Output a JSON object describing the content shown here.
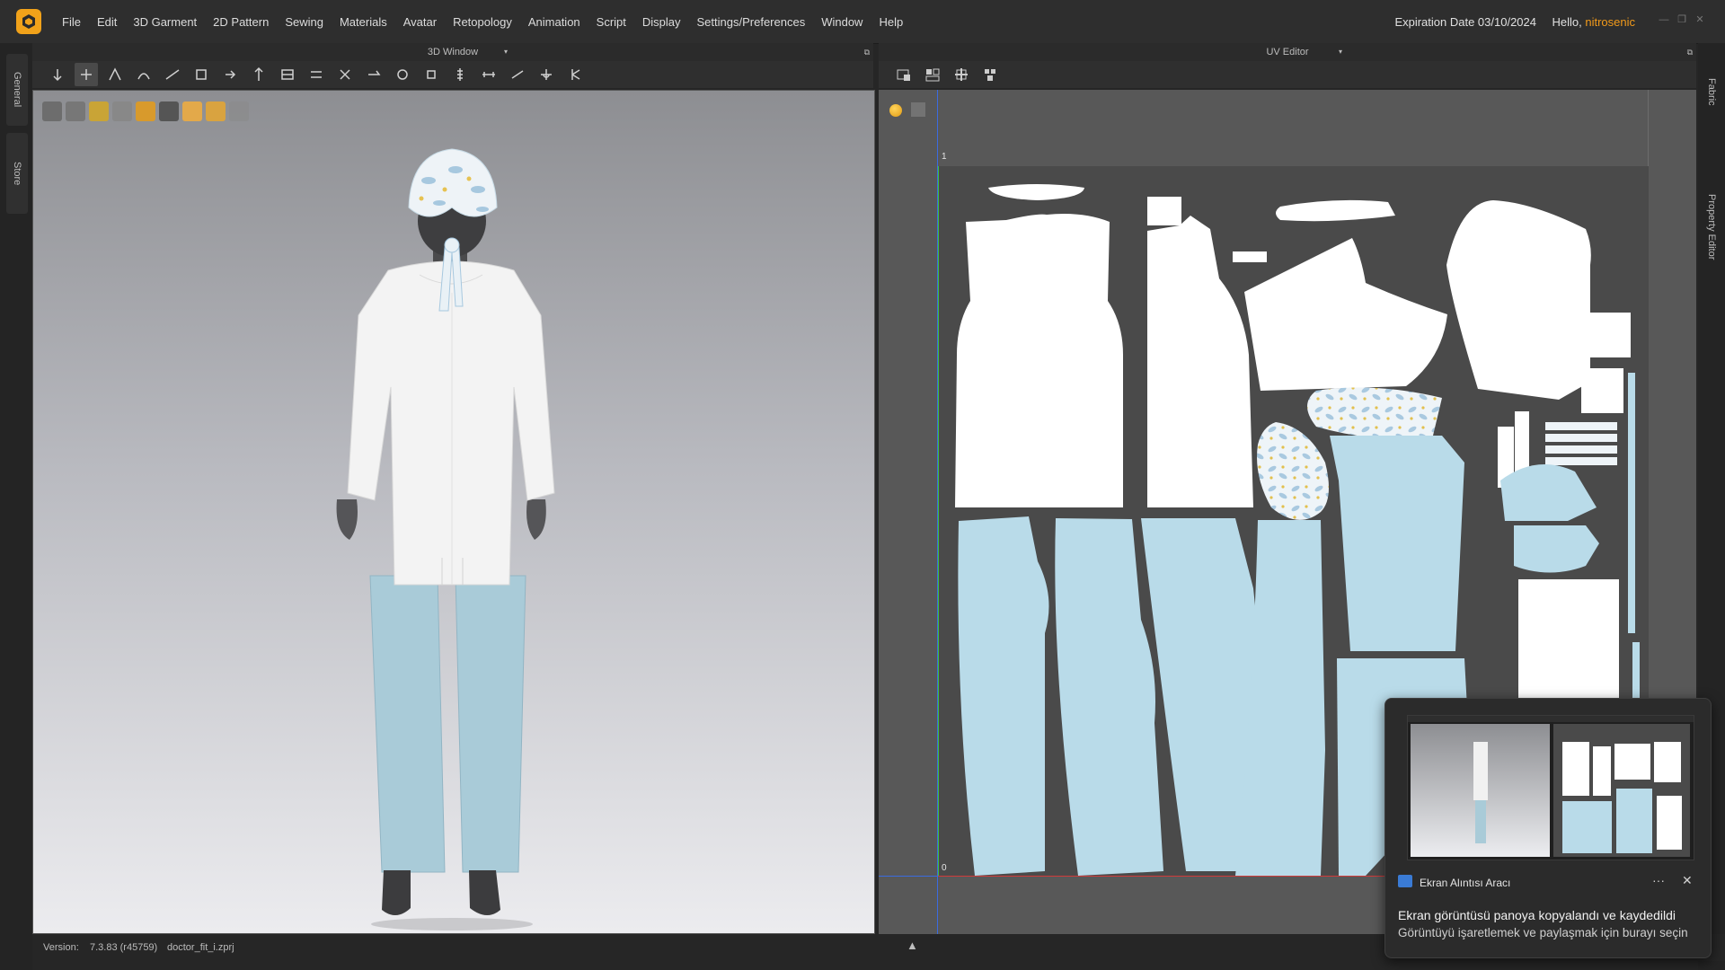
{
  "app": {
    "menu": [
      "File",
      "Edit",
      "3D Garment",
      "2D Pattern",
      "Sewing",
      "Materials",
      "Avatar",
      "Retopology",
      "Animation",
      "Script",
      "Display",
      "Settings/Preferences",
      "Window",
      "Help"
    ],
    "expiration": "Expiration Date 03/10/2024",
    "hello_prefix": "Hello,",
    "username": "nitrosenic",
    "accent_color": "#f29a1a"
  },
  "left_dock": {
    "tabs": [
      "General",
      "Store"
    ]
  },
  "right_dock": {
    "tabs": [
      "Fabric",
      "Property Editor"
    ]
  },
  "view3d": {
    "title": "3D Window",
    "toolbar_icons": [
      "select-move-icon",
      "transform-icon",
      "edit-point-icon",
      "edit-curvature-icon",
      "ruler-icon",
      "steam-icon",
      "fold-icon",
      "pin-icon",
      "strengthen-icon",
      "tuck-icon",
      "shrinkage-icon",
      "fitting-icon",
      "button-icon",
      "buttonhole-icon",
      "zipper-icon",
      "measure-icon",
      "tape-icon",
      "avatar-measure-icon",
      "simulate-icon"
    ]
  },
  "uv_editor": {
    "title": "UV Editor",
    "axis_label_top": "1",
    "axis_label_bottom": "0"
  },
  "statusbar": {
    "version_label": "Version:",
    "version": "7.3.83 (r45759)",
    "filename": "doctor_fit_i.zprj"
  },
  "toast": {
    "app_name": "Ekran Alıntısı Aracı",
    "more": "···",
    "close": "✕",
    "message": "Ekran görüntüsü panoya kopyalandı ve kaydedildi",
    "submessage": "Görüntüyü işaretlemek ve paylaşmak için burayı seçin"
  }
}
